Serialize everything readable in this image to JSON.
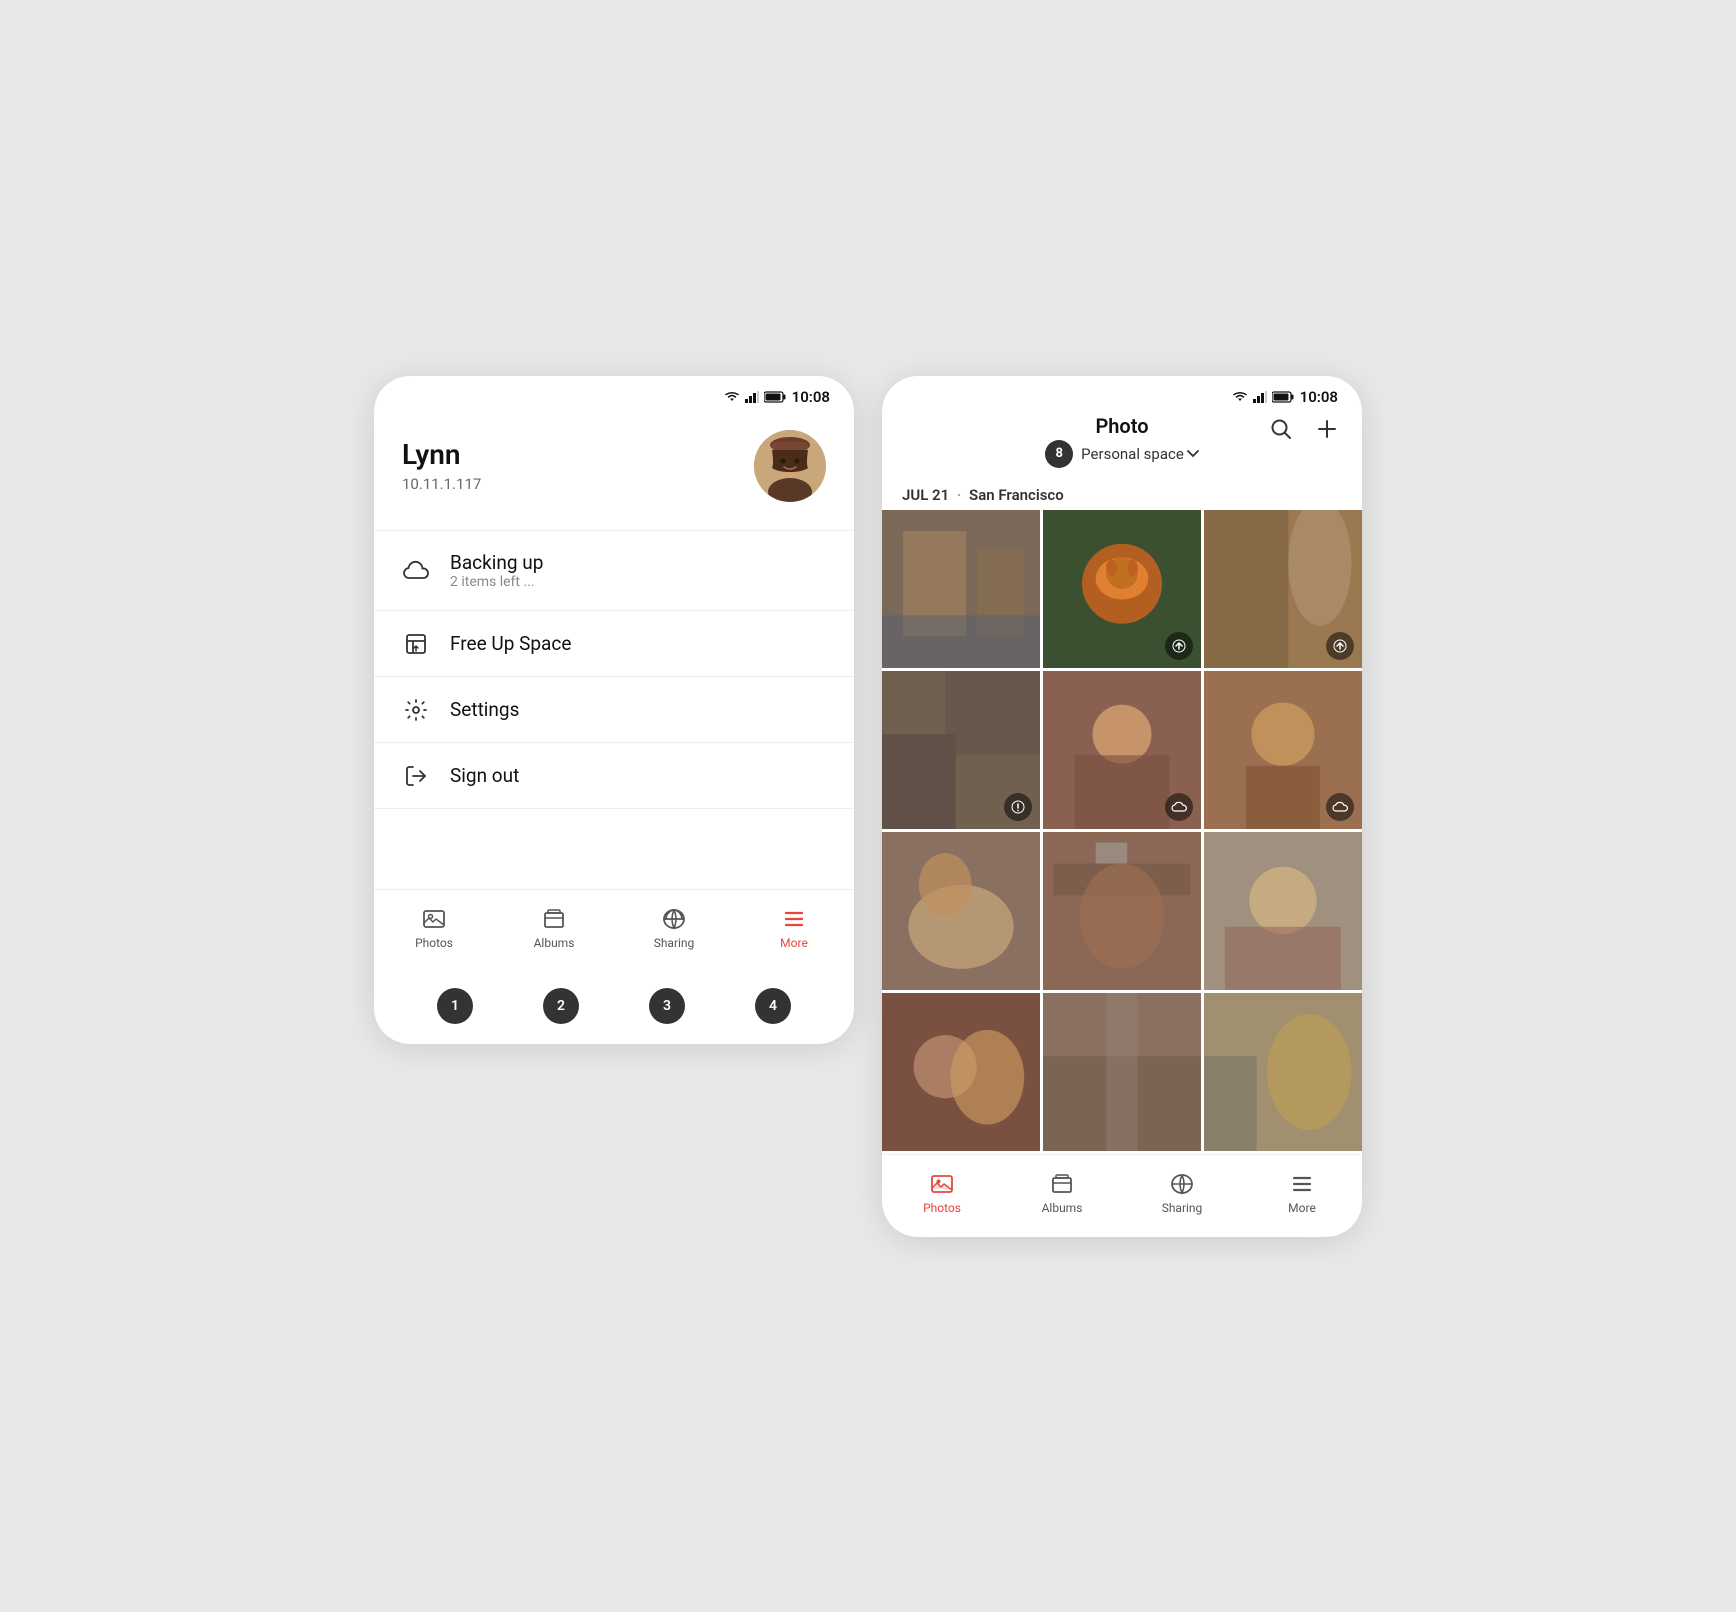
{
  "left_phone": {
    "status_bar": {
      "time": "10:08"
    },
    "user": {
      "name": "Lynn",
      "ip": "10.11.1.117"
    },
    "menu_items": [
      {
        "id": 5,
        "icon": "cloud",
        "label": "Backing up",
        "sublabel": "2 items left ..."
      },
      {
        "id": 6,
        "icon": "free-space",
        "label": "Free Up Space",
        "sublabel": ""
      },
      {
        "id": 7,
        "icon": "settings",
        "label": "Settings",
        "sublabel": ""
      },
      {
        "id": null,
        "icon": "signout",
        "label": "Sign out",
        "sublabel": ""
      }
    ],
    "bottom_nav": [
      {
        "icon": "photos",
        "label": "Photos",
        "active": false
      },
      {
        "icon": "albums",
        "label": "Albums",
        "active": false
      },
      {
        "icon": "sharing",
        "label": "Sharing",
        "active": false
      },
      {
        "icon": "more",
        "label": "More",
        "active": true
      }
    ],
    "bottom_numbers": [
      "1",
      "2",
      "3",
      "4"
    ]
  },
  "right_phone": {
    "status_bar": {
      "time": "10:08"
    },
    "header": {
      "title": "Photo",
      "badge_count": "8",
      "space_label": "Personal space"
    },
    "date_label": "JUL 21",
    "location_label": "San Francisco",
    "photos": [
      {
        "id": "p1",
        "has_upload": false,
        "has_download": false,
        "has_warning": false,
        "has_cloud": false
      },
      {
        "id": "p2",
        "has_upload": true,
        "has_download": false,
        "has_warning": false,
        "has_cloud": false
      },
      {
        "id": "p3",
        "has_upload": true,
        "has_download": false,
        "has_warning": false,
        "has_cloud": false
      },
      {
        "id": "p4",
        "has_upload": false,
        "has_download": false,
        "has_warning": false,
        "has_cloud": false
      },
      {
        "id": "p5",
        "has_upload": false,
        "has_download": false,
        "has_warning": true,
        "has_cloud": false
      },
      {
        "id": "p6",
        "has_upload": false,
        "has_download": false,
        "has_warning": false,
        "has_cloud": true
      },
      {
        "id": "p7",
        "has_upload": false,
        "has_download": false,
        "has_warning": false,
        "has_cloud": true
      },
      {
        "id": "p8",
        "has_upload": false,
        "has_download": false,
        "has_warning": false,
        "has_cloud": false
      },
      {
        "id": "p9",
        "has_upload": false,
        "has_download": false,
        "has_warning": false,
        "has_cloud": false
      },
      {
        "id": "p10",
        "has_upload": false,
        "has_download": false,
        "has_warning": false,
        "has_cloud": false
      },
      {
        "id": "p11",
        "has_upload": false,
        "has_download": false,
        "has_warning": false,
        "has_cloud": false
      },
      {
        "id": "p12",
        "has_upload": false,
        "has_download": false,
        "has_warning": false,
        "has_cloud": false
      }
    ],
    "bottom_nav": [
      {
        "icon": "photos",
        "label": "Photos",
        "active": true
      },
      {
        "icon": "albums",
        "label": "Albums",
        "active": false
      },
      {
        "icon": "sharing",
        "label": "Sharing",
        "active": false
      },
      {
        "icon": "more",
        "label": "More",
        "active": false
      }
    ]
  }
}
